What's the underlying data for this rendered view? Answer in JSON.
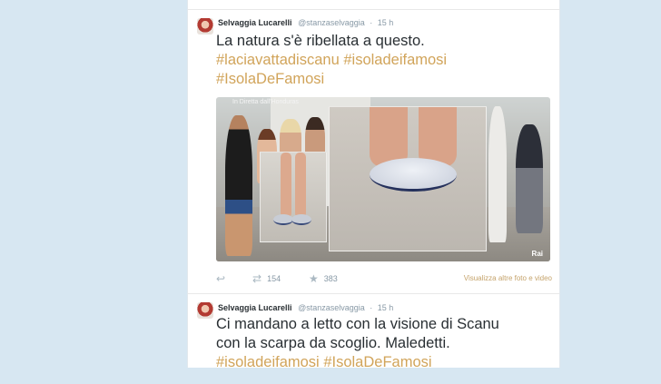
{
  "tweets": [
    {
      "author_name": "Selvaggia Lucarelli",
      "handle": "@stanzaselvaggia",
      "time": "15 h",
      "text": "La natura s'è ribellata a questo.",
      "hashtags": [
        "#laciavattadiscanu",
        "#isoladeifamosi",
        "#IsolaDeFamosi"
      ],
      "media": {
        "watermark": "In Diretta dall'Honduras",
        "channel_logo": "Rai"
      },
      "retweets": "154",
      "favorites": "383",
      "media_link": "Visualizza altre foto e video",
      "icons": {
        "reply": "reply-icon",
        "retweet": "retweet-icon",
        "favorite": "star-icon"
      }
    },
    {
      "author_name": "Selvaggia Lucarelli",
      "handle": "@stanzaselvaggia",
      "time": "15 h",
      "text_line1": "Ci mandano a letto con la visione di Scanu",
      "text_line2": "con la scarpa da scoglio. Maledetti.",
      "hashtags": [
        "#isoladeifamosi",
        "#IsolaDeFamosi"
      ]
    }
  ],
  "colors": {
    "background": "#d7e7f2",
    "hashtag": "#d1a45a",
    "link": "#c5a36b"
  }
}
